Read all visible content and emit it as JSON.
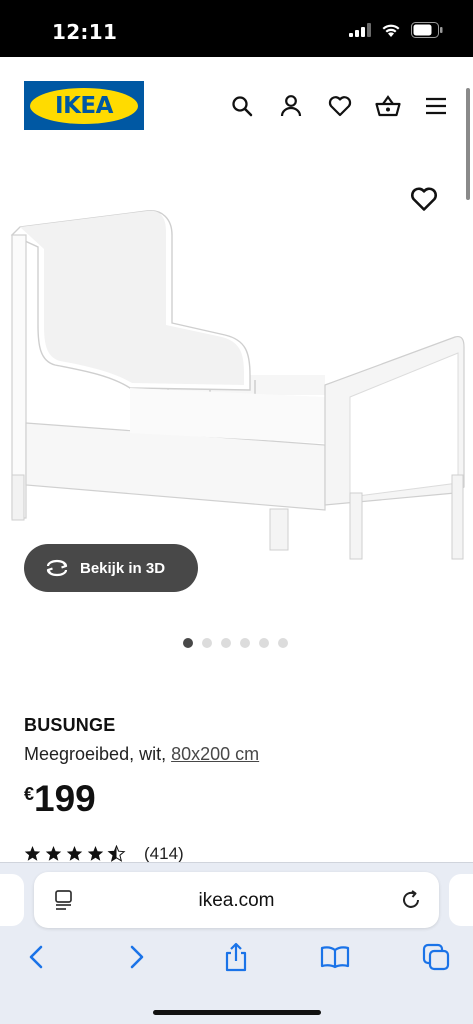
{
  "status_bar": {
    "time": "12:11"
  },
  "header": {
    "logo_text": "IKEA",
    "icons": [
      "search-icon",
      "user-icon",
      "heart-icon",
      "basket-icon",
      "menu-icon"
    ]
  },
  "gallery": {
    "view3d_label": "Bekijk in 3D",
    "total_images": 6,
    "active_index": 0
  },
  "product": {
    "name": "BUSUNGE",
    "description": "Meegroeibed, wit,",
    "size_link": "80x200 cm",
    "currency": "€",
    "price": "199",
    "rating_stars": 4.5,
    "rating_count": "(414)"
  },
  "browser": {
    "url": "ikea.com",
    "toolbar_icons": [
      "back-icon",
      "forward-icon",
      "share-icon",
      "bookmarks-icon",
      "tabs-icon"
    ]
  },
  "colors": {
    "ikea_blue": "#0058a3",
    "ikea_yellow": "#ffdb00",
    "safari_accent": "#1a73e8",
    "button_dark": "#484848"
  }
}
